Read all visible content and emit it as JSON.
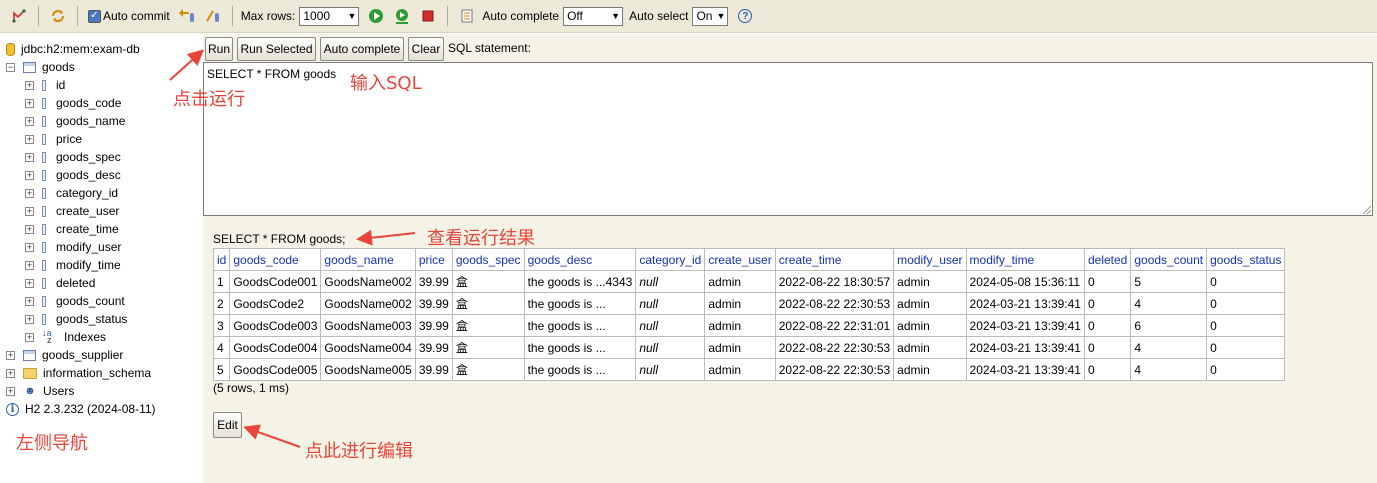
{
  "toolbar": {
    "auto_commit_label": "Auto commit",
    "max_rows_label": "Max rows:",
    "max_rows_value": "1000",
    "auto_complete_label": "Auto complete",
    "auto_complete_value": "Off",
    "auto_select_label": "Auto select",
    "auto_select_value": "On",
    "help_icon": "?"
  },
  "tree": {
    "connection": "jdbc:h2:mem:exam-db",
    "table": "goods",
    "columns": [
      "id",
      "goods_code",
      "goods_name",
      "price",
      "goods_spec",
      "goods_desc",
      "category_id",
      "create_user",
      "create_time",
      "modify_user",
      "modify_time",
      "deleted",
      "goods_count",
      "goods_status"
    ],
    "indexes": "Indexes",
    "other_table": "goods_supplier",
    "schema": "information_schema",
    "users": "Users",
    "version": "H2 2.3.232 (2024-08-11)"
  },
  "buttons": {
    "run": "Run",
    "run_selected": "Run Selected",
    "auto_complete": "Auto complete",
    "clear": "Clear",
    "edit": "Edit"
  },
  "sql": {
    "label": "SQL statement:",
    "text": "SELECT * FROM goods",
    "result_statement": "SELECT * FROM goods;"
  },
  "results": {
    "headers": [
      "id",
      "goods_code",
      "goods_name",
      "price",
      "goods_spec",
      "goods_desc",
      "category_id",
      "create_user",
      "create_time",
      "modify_user",
      "modify_time",
      "deleted",
      "goods_count",
      "goods_status"
    ],
    "rows": [
      [
        "1",
        "GoodsCode001",
        "GoodsName002",
        "39.99",
        "盒",
        "the goods is ...4343",
        "null",
        "admin",
        "2022-08-22 18:30:57",
        "admin",
        "2024-05-08 15:36:11",
        "0",
        "5",
        "0"
      ],
      [
        "2",
        "GoodsCode2",
        "GoodsName002",
        "39.99",
        "盒",
        "the goods is ...",
        "null",
        "admin",
        "2022-08-22 22:30:53",
        "admin",
        "2024-03-21 13:39:41",
        "0",
        "4",
        "0"
      ],
      [
        "3",
        "GoodsCode003",
        "GoodsName003",
        "39.99",
        "盒",
        "the goods is ...",
        "null",
        "admin",
        "2022-08-22 22:31:01",
        "admin",
        "2024-03-21 13:39:41",
        "0",
        "6",
        "0"
      ],
      [
        "4",
        "GoodsCode004",
        "GoodsName004",
        "39.99",
        "盒",
        "the goods is ...",
        "null",
        "admin",
        "2022-08-22 22:30:53",
        "admin",
        "2024-03-21 13:39:41",
        "0",
        "4",
        "0"
      ],
      [
        "5",
        "GoodsCode005",
        "GoodsName005",
        "39.99",
        "盒",
        "the goods is ...",
        "null",
        "admin",
        "2022-08-22 22:30:53",
        "admin",
        "2024-03-21 13:39:41",
        "0",
        "4",
        "0"
      ]
    ],
    "summary": "(5 rows, 1 ms)"
  },
  "annotations": {
    "run": "点击运行",
    "input_sql": "输入SQL",
    "view_result": "查看运行结果",
    "left_nav": "左侧导航",
    "edit": "点此进行编辑"
  },
  "colors": {
    "annotation": "#e8443a",
    "header_link": "#1533b8",
    "toolbar_bg": "#ece9d8",
    "panel_bg": "#f5f3e6"
  }
}
